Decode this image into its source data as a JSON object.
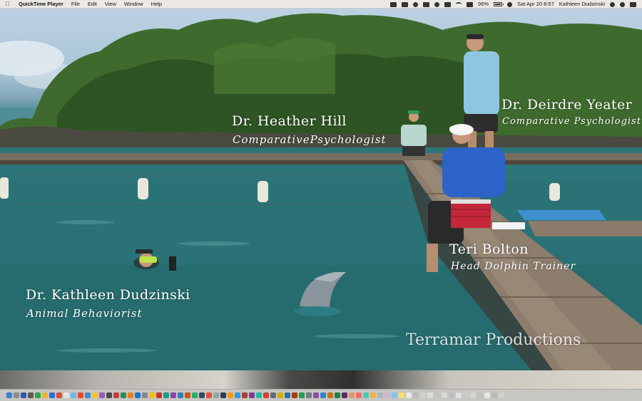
{
  "menubar": {
    "app_name": "QuickTime Player",
    "menus": [
      "File",
      "Edit",
      "View",
      "Window",
      "Help"
    ],
    "battery": "96%",
    "datetime": "Sat Apr 20  8:57",
    "user": "Kathleen Dudzinski"
  },
  "video": {
    "captions": {
      "hill_name": "Dr. Heather Hill",
      "hill_role": "ComparativePsychologist",
      "yeater_name": "Dr. Deirdre Yeater",
      "yeater_role": "Comparative Psychologist",
      "bolton_name": "Teri Bolton",
      "bolton_role": "Head Dolphin Trainer",
      "dudzinski_name": "Dr. Kathleen Dudzinski",
      "dudzinski_role": "Animal Behaviorist",
      "credit": "Terramar Productions"
    }
  },
  "dock": {
    "icon_colors": [
      "#3b7ddd",
      "#8a8a8a",
      "#2f5aa8",
      "#5a5a5a",
      "#2aa84a",
      "#e8b23a",
      "#2c6fd6",
      "#d94b3a",
      "#e4e4e4",
      "#6fb8e8",
      "#e44d3a",
      "#3d8bd9",
      "#f0c43a",
      "#9b59b6",
      "#4a4a4a",
      "#c83a3a",
      "#2e8b57",
      "#e67e22",
      "#1f6fd6",
      "#7f8c8d",
      "#f1c40f",
      "#c0392b",
      "#16a085",
      "#8e44ad",
      "#2980b9",
      "#d35400",
      "#27ae60",
      "#34495e",
      "#e74c3c",
      "#95a5a6",
      "#2c3e50",
      "#f39c12",
      "#3498db",
      "#b03a2e",
      "#7d3c98",
      "#1abc9c",
      "#cb4335",
      "#5d6d7e",
      "#d4ac0d",
      "#2874a6",
      "#a04000",
      "#239b56",
      "#717d7e",
      "#884ea0",
      "#2e86c1",
      "#ca6f1e",
      "#1d8348",
      "#5b2c6f",
      "#e59866",
      "#ec7063",
      "#48c9b0",
      "#f5b041",
      "#aab7b8",
      "#d2b4de",
      "#85c1e9",
      "#f7dc6f",
      "#e8e8e8",
      "#bbbbbb",
      "#cfcfcf",
      "#dddddd",
      "#c4c4c4",
      "#d8d8d8",
      "#bdbdbd",
      "#e0e0e0",
      "#cacaca",
      "#d5d5d5",
      "#c0c0c0",
      "#e6e6e6",
      "#b8b8b8",
      "#d0d0d0"
    ]
  }
}
